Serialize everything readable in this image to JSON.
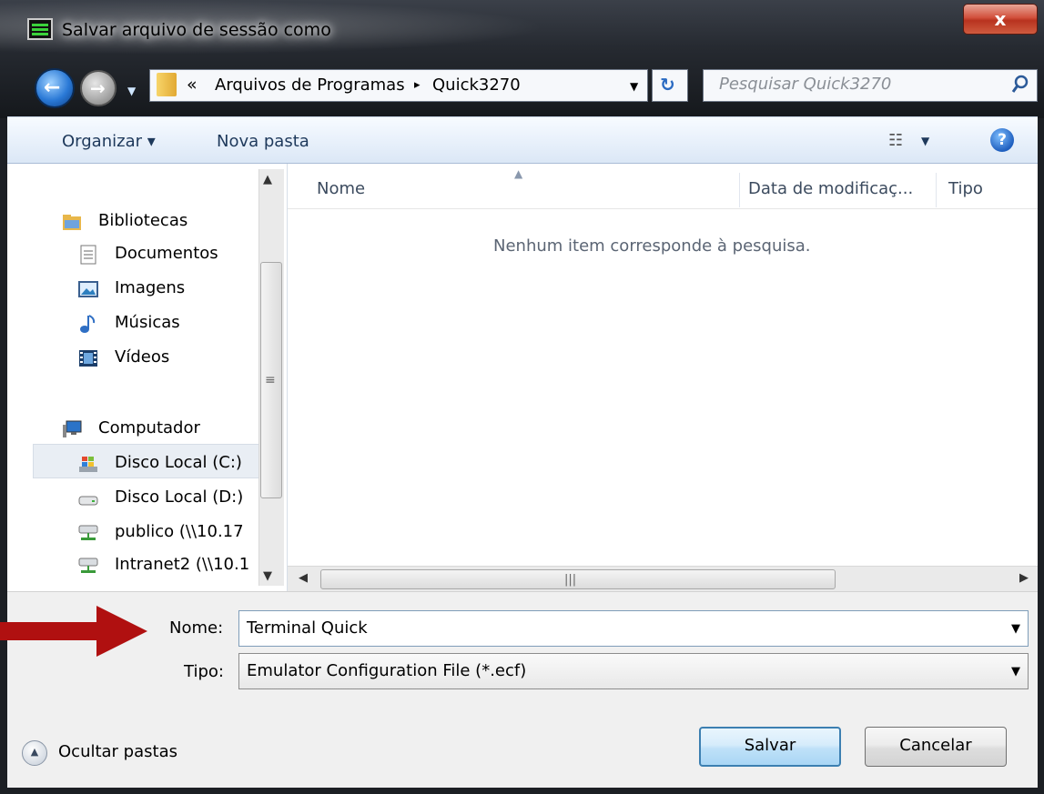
{
  "window": {
    "title": "Salvar arquivo de sessão como",
    "close_label": "x"
  },
  "nav": {
    "back_glyph": "←",
    "forward_glyph": "→",
    "address": {
      "overflow_glyph": "«",
      "crumbs": [
        "Arquivos de Programas",
        "Quick3270"
      ],
      "separator": "▸"
    },
    "search": {
      "placeholder": "Pesquisar Quick3270"
    }
  },
  "toolbar": {
    "organize": "Organizar ▾",
    "new_folder": "Nova pasta",
    "help_glyph": "?"
  },
  "sidebar": {
    "items": [
      {
        "label": "Bibliotecas",
        "icon": "libraries-icon"
      },
      {
        "label": "Documentos",
        "icon": "documents-icon"
      },
      {
        "label": "Imagens",
        "icon": "pictures-icon"
      },
      {
        "label": "Músicas",
        "icon": "music-icon"
      },
      {
        "label": "Vídeos",
        "icon": "videos-icon"
      },
      {
        "label": "Computador",
        "icon": "computer-icon"
      },
      {
        "label": "Disco Local (C:)",
        "icon": "system-drive-icon"
      },
      {
        "label": "Disco Local (D:)",
        "icon": "drive-icon"
      },
      {
        "label": "publico (\\\\10.17",
        "icon": "network-drive-icon"
      },
      {
        "label": "Intranet2 (\\\\10.1",
        "icon": "network-drive-icon"
      }
    ],
    "selected": "Disco Local (C:)"
  },
  "content": {
    "columns": [
      "Nome",
      "Data de modificaç...",
      "Tipo"
    ],
    "empty_message": "Nenhum item corresponde à pesquisa."
  },
  "form": {
    "name_label": "Nome:",
    "name_value": "Terminal Quick",
    "type_label": "Tipo:",
    "type_value": "Emulator Configuration File (*.ecf)"
  },
  "footer": {
    "hide_folders": "Ocultar pastas",
    "save": "Salvar",
    "cancel": "Cancelar"
  },
  "colors": {
    "annotation_arrow": "#b01010",
    "toolbar_text": "#1e395b",
    "save_border": "#3c7fb1"
  }
}
